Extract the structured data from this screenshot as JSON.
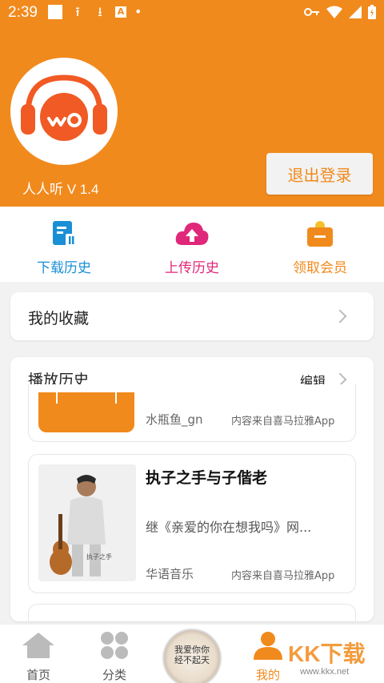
{
  "status_bar": {
    "time": "2:39",
    "icons": [
      "square-icon",
      "upload-icon",
      "download-icon",
      "a-icon",
      "dot-icon",
      "key-icon",
      "wifi-icon",
      "signal-icon",
      "battery-icon"
    ]
  },
  "header": {
    "app_version": "人人听 V 1.4",
    "logout_label": "退出登录",
    "accent_color": "#f18a1c"
  },
  "quick_actions": [
    {
      "label": "下载历史",
      "color": "#1a8fd6",
      "icon": "download-history-icon"
    },
    {
      "label": "上传历史",
      "color": "#e0287a",
      "icon": "upload-history-icon"
    },
    {
      "label": "领取会员",
      "color": "#f18a1c",
      "icon": "membership-icon"
    }
  ],
  "favorites": {
    "title": "我的收藏"
  },
  "history": {
    "title": "播放历史",
    "edit_label": "编辑",
    "items": [
      {
        "title": "",
        "description": "",
        "author": "水瓶鱼_gn",
        "source": "内容来自喜马拉雅App"
      },
      {
        "title": "执子之手与子偕老",
        "description": "继《亲爱的你在想我吗》网...",
        "author": "华语音乐",
        "source": "内容来自喜马拉雅App"
      }
    ]
  },
  "bottom_nav": {
    "items": [
      {
        "label": "首页",
        "icon": "home-icon"
      },
      {
        "label": "分类",
        "icon": "category-icon"
      },
      {
        "label": "我的",
        "icon": "profile-icon"
      }
    ],
    "player_disc_text": "我爱你你\n经不起天"
  },
  "watermark": {
    "text": "KK下载",
    "url": "www.kkx.net"
  }
}
